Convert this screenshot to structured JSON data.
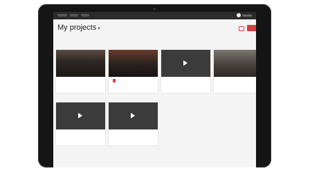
{
  "app": {
    "page_title": "My projects",
    "create_button_label": "",
    "user_name": ""
  },
  "colors": {
    "accent": "#e2393b",
    "screen_bg": "#f4f4f4",
    "bezel": "#151515",
    "topbar": "#2b2b2b"
  },
  "icons": {
    "title_chevron": "chevron-down-icon",
    "play": "play-icon",
    "toolbar": "folder-icon",
    "user": "user-avatar-icon"
  },
  "projects": [
    {
      "title": "",
      "badge": "",
      "duration": ""
    },
    {
      "title": "",
      "badge": "",
      "duration": ""
    },
    {
      "title": "",
      "badge": "",
      "duration": ""
    },
    {
      "title": "",
      "badge": "",
      "duration": ""
    },
    {
      "title": "",
      "badge": "",
      "duration": ""
    },
    {
      "title": "",
      "badge": "",
      "duration": ""
    }
  ]
}
